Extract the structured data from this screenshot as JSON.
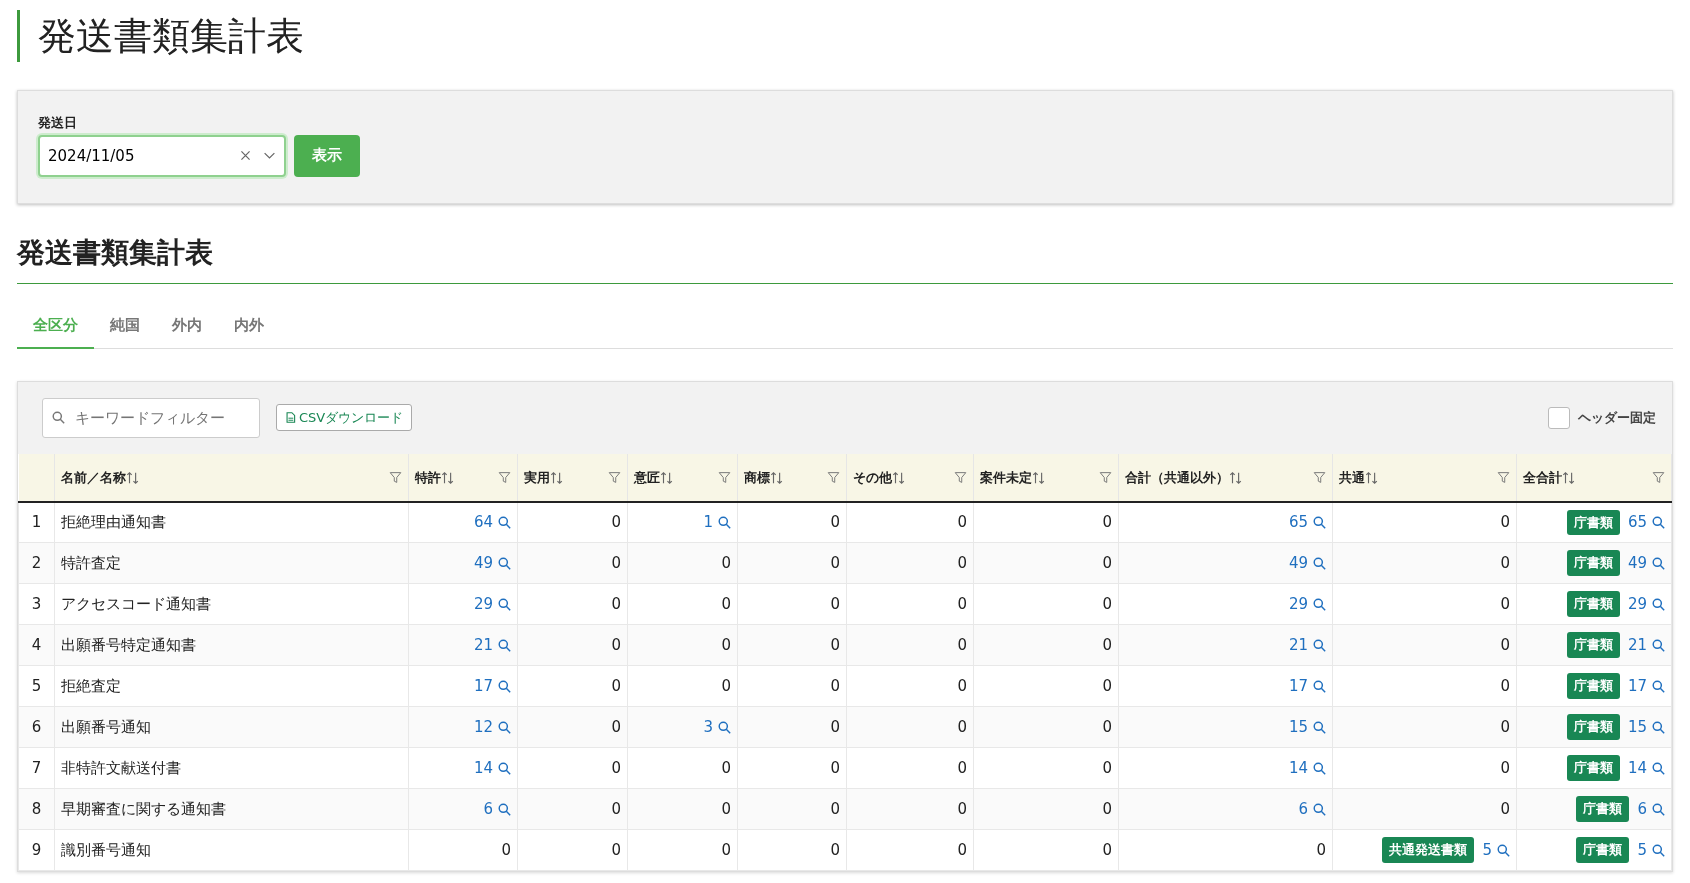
{
  "page_title": "発送書類集計表",
  "filter": {
    "label": "発送日",
    "value": "2024/11/05",
    "submit": "表示"
  },
  "section_title": "発送書類集計表",
  "tabs": [
    {
      "label": "全区分",
      "selected": true
    },
    {
      "label": "純国",
      "selected": false
    },
    {
      "label": "外内",
      "selected": false
    },
    {
      "label": "内外",
      "selected": false
    }
  ],
  "toolbar": {
    "search_placeholder": "キーワードフィルター",
    "csv_button": "CSVダウンロード",
    "sticky_header": {
      "label": "ヘッダー固定",
      "checked": false
    }
  },
  "table": {
    "columns": [
      "",
      "名前／名称",
      "特許",
      "実用",
      "意匠",
      "商標",
      "その他",
      "案件未定",
      "合計（共通以外）",
      "共通",
      "全合計"
    ],
    "rows": [
      {
        "cells": [
          {
            "value": "1"
          },
          {
            "value": "拒絶理由通知書"
          },
          {
            "value": "64",
            "link": true
          },
          {
            "value": "0",
            "link": false
          },
          {
            "value": "1",
            "link": true
          },
          {
            "value": "0",
            "link": false
          },
          {
            "value": "0",
            "link": false
          },
          {
            "value": "0",
            "link": false
          },
          {
            "value": "65",
            "link": true
          },
          {
            "value": "0",
            "link": false
          },
          {
            "value": "65",
            "link": true,
            "badge": "庁書類"
          }
        ]
      },
      {
        "cells": [
          {
            "value": "2"
          },
          {
            "value": "特許査定"
          },
          {
            "value": "49",
            "link": true
          },
          {
            "value": "0",
            "link": false
          },
          {
            "value": "0",
            "link": false
          },
          {
            "value": "0",
            "link": false
          },
          {
            "value": "0",
            "link": false
          },
          {
            "value": "0",
            "link": false
          },
          {
            "value": "49",
            "link": true
          },
          {
            "value": "0",
            "link": false
          },
          {
            "value": "49",
            "link": true,
            "badge": "庁書類"
          }
        ]
      },
      {
        "cells": [
          {
            "value": "3"
          },
          {
            "value": "アクセスコード通知書"
          },
          {
            "value": "29",
            "link": true
          },
          {
            "value": "0",
            "link": false
          },
          {
            "value": "0",
            "link": false
          },
          {
            "value": "0",
            "link": false
          },
          {
            "value": "0",
            "link": false
          },
          {
            "value": "0",
            "link": false
          },
          {
            "value": "29",
            "link": true
          },
          {
            "value": "0",
            "link": false
          },
          {
            "value": "29",
            "link": true,
            "badge": "庁書類"
          }
        ]
      },
      {
        "cells": [
          {
            "value": "4"
          },
          {
            "value": "出願番号特定通知書"
          },
          {
            "value": "21",
            "link": true
          },
          {
            "value": "0",
            "link": false
          },
          {
            "value": "0",
            "link": false
          },
          {
            "value": "0",
            "link": false
          },
          {
            "value": "0",
            "link": false
          },
          {
            "value": "0",
            "link": false
          },
          {
            "value": "21",
            "link": true
          },
          {
            "value": "0",
            "link": false
          },
          {
            "value": "21",
            "link": true,
            "badge": "庁書類"
          }
        ]
      },
      {
        "cells": [
          {
            "value": "5"
          },
          {
            "value": "拒絶査定"
          },
          {
            "value": "17",
            "link": true
          },
          {
            "value": "0",
            "link": false
          },
          {
            "value": "0",
            "link": false
          },
          {
            "value": "0",
            "link": false
          },
          {
            "value": "0",
            "link": false
          },
          {
            "value": "0",
            "link": false
          },
          {
            "value": "17",
            "link": true
          },
          {
            "value": "0",
            "link": false
          },
          {
            "value": "17",
            "link": true,
            "badge": "庁書類"
          }
        ]
      },
      {
        "cells": [
          {
            "value": "6"
          },
          {
            "value": "出願番号通知"
          },
          {
            "value": "12",
            "link": true
          },
          {
            "value": "0",
            "link": false
          },
          {
            "value": "3",
            "link": true
          },
          {
            "value": "0",
            "link": false
          },
          {
            "value": "0",
            "link": false
          },
          {
            "value": "0",
            "link": false
          },
          {
            "value": "15",
            "link": true
          },
          {
            "value": "0",
            "link": false
          },
          {
            "value": "15",
            "link": true,
            "badge": "庁書類"
          }
        ]
      },
      {
        "cells": [
          {
            "value": "7"
          },
          {
            "value": "非特許文献送付書"
          },
          {
            "value": "14",
            "link": true
          },
          {
            "value": "0",
            "link": false
          },
          {
            "value": "0",
            "link": false
          },
          {
            "value": "0",
            "link": false
          },
          {
            "value": "0",
            "link": false
          },
          {
            "value": "0",
            "link": false
          },
          {
            "value": "14",
            "link": true
          },
          {
            "value": "0",
            "link": false
          },
          {
            "value": "14",
            "link": true,
            "badge": "庁書類"
          }
        ]
      },
      {
        "cells": [
          {
            "value": "8"
          },
          {
            "value": "早期審査に関する通知書"
          },
          {
            "value": "6",
            "link": true
          },
          {
            "value": "0",
            "link": false
          },
          {
            "value": "0",
            "link": false
          },
          {
            "value": "0",
            "link": false
          },
          {
            "value": "0",
            "link": false
          },
          {
            "value": "0",
            "link": false
          },
          {
            "value": "6",
            "link": true
          },
          {
            "value": "0",
            "link": false
          },
          {
            "value": "6",
            "link": true,
            "badge": "庁書類"
          }
        ]
      },
      {
        "cells": [
          {
            "value": "9"
          },
          {
            "value": "識別番号通知"
          },
          {
            "value": "0",
            "link": false
          },
          {
            "value": "0",
            "link": false
          },
          {
            "value": "0",
            "link": false
          },
          {
            "value": "0",
            "link": false
          },
          {
            "value": "0",
            "link": false
          },
          {
            "value": "0",
            "link": false
          },
          {
            "value": "0",
            "link": false
          },
          {
            "value": "5",
            "link": true,
            "badge": "共通発送書類"
          },
          {
            "value": "5",
            "link": true,
            "badge": "庁書類"
          }
        ]
      }
    ]
  }
}
